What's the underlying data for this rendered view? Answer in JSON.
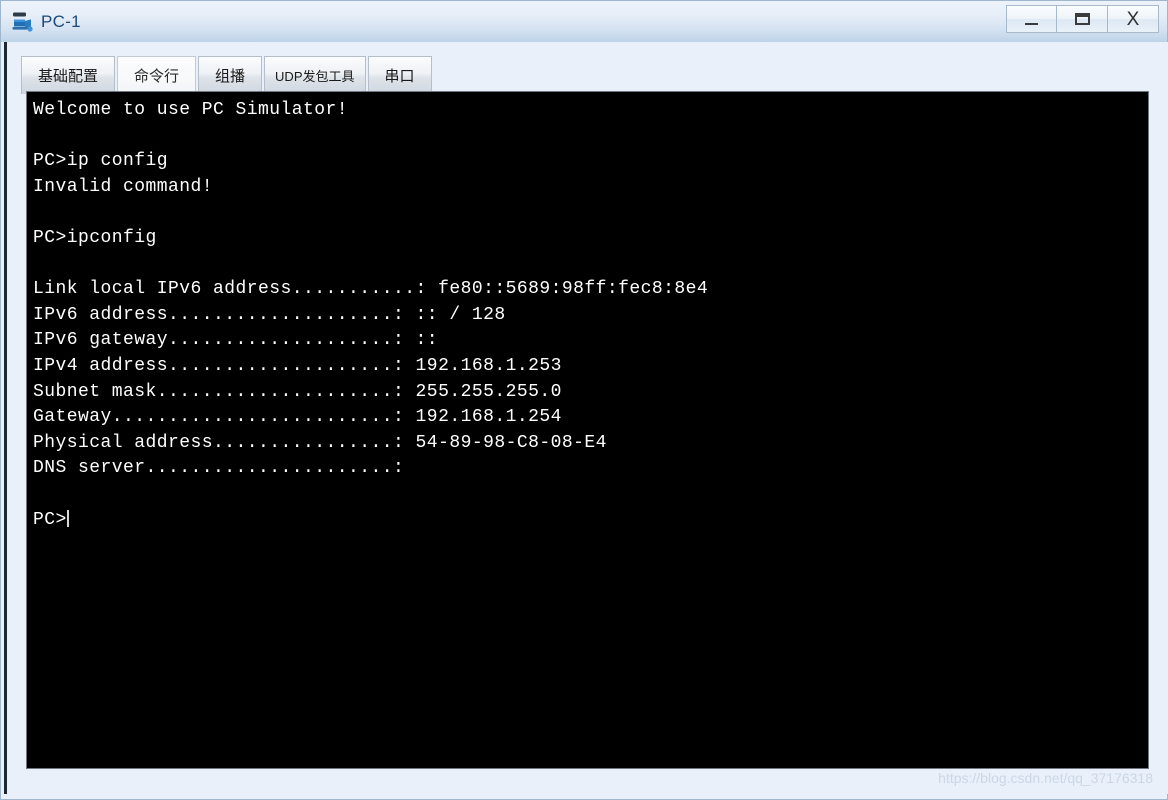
{
  "window": {
    "title": "PC-1",
    "icon": "pc-device-icon",
    "controls": {
      "minimize_label": "–",
      "maximize_label": "□",
      "close_label": "X",
      "minimize_name": "minimize-button",
      "maximize_name": "maximize-button",
      "close_name": "close-button"
    },
    "colors": {
      "titlebar_top": "#eef3fb",
      "titlebar_bottom": "#bed3e8",
      "title_text": "#1c4a7a",
      "frame_border": "#9fb6cc",
      "terminal_bg": "#000000",
      "terminal_fg": "#ffffff",
      "client_bg": "#eaf0fa"
    }
  },
  "tabs": [
    {
      "label": "基础配置",
      "active": false
    },
    {
      "label": "命令行",
      "active": true
    },
    {
      "label": "组播",
      "active": false
    },
    {
      "label": "UDP发包工具",
      "active": false
    },
    {
      "label": "串口",
      "active": false
    }
  ],
  "terminal": {
    "lines": [
      "Welcome to use PC Simulator!",
      "",
      "PC>ip config",
      "Invalid command!",
      "",
      "PC>ipconfig",
      "",
      "Link local IPv6 address...........: fe80::5689:98ff:fec8:8e4",
      "IPv6 address....................: :: / 128",
      "IPv6 gateway....................: ::",
      "IPv4 address....................: 192.168.1.253",
      "Subnet mask.....................: 255.255.255.0",
      "Gateway.........................: 192.168.1.254",
      "Physical address................: 54-89-98-C8-08-E4",
      "DNS server......................:",
      "",
      "PC>"
    ],
    "prompt": "PC>",
    "cursor_visible": true
  },
  "watermark": {
    "text": "https://blog.csdn.net/qq_37176318"
  }
}
